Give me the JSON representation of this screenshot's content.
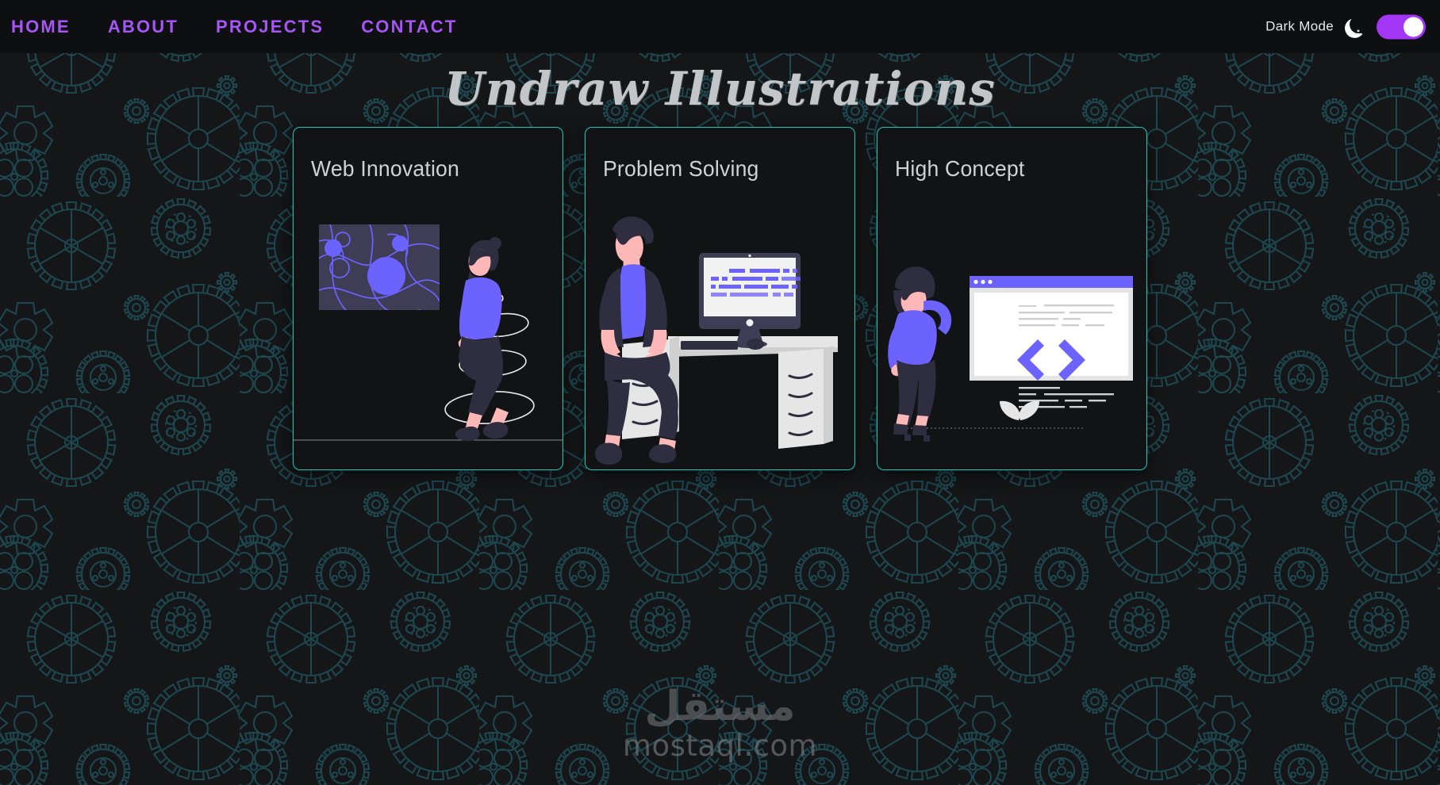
{
  "page": {
    "title": "Undraw Illustrations",
    "background_color": "#141618",
    "pattern": "gear-outline-pattern",
    "pattern_color": "#1d464f"
  },
  "navbar": {
    "background_color": "#0d0f10",
    "accent_color": "#a855f7",
    "links": [
      {
        "label": "HOME",
        "name": "home"
      },
      {
        "label": "ABOUT",
        "name": "about"
      },
      {
        "label": "PROJECTS",
        "name": "projects"
      },
      {
        "label": "CONTACT",
        "name": "contact"
      }
    ],
    "dark_mode": {
      "label": "Dark Mode",
      "icon": "moon-icon",
      "toggle_state": "on",
      "toggle_color": "#a335f5",
      "knob_color": "#ffffff"
    }
  },
  "cards": [
    {
      "title": "Web Innovation",
      "name": "web-innovation",
      "illustration": "woman-walking-with-abstract-panel",
      "border_color": "#17c9c0",
      "background_color": "#111314"
    },
    {
      "title": "Problem Solving",
      "name": "problem-solving",
      "illustration": "man-sitting-on-cabinet-beside-desk-with-monitor",
      "border_color": "#17c9c0",
      "background_color": "#111314"
    },
    {
      "title": "High Concept",
      "name": "high-concept",
      "illustration": "woman-standing-beside-browser-window-with-code-brackets",
      "border_color": "#17c9c0",
      "background_color": "#111314"
    }
  ],
  "watermark": {
    "arabic": "مستقل",
    "domain": "mostaql.com"
  },
  "illustration_palette": {
    "purple": "#6c63ff",
    "dark_navy": "#2f2e41",
    "slate": "#3f3d56",
    "skin": "#ffb8b8",
    "light_gray": "#e6e6e6",
    "off_white": "#f2f2f2",
    "white": "#ffffff"
  }
}
